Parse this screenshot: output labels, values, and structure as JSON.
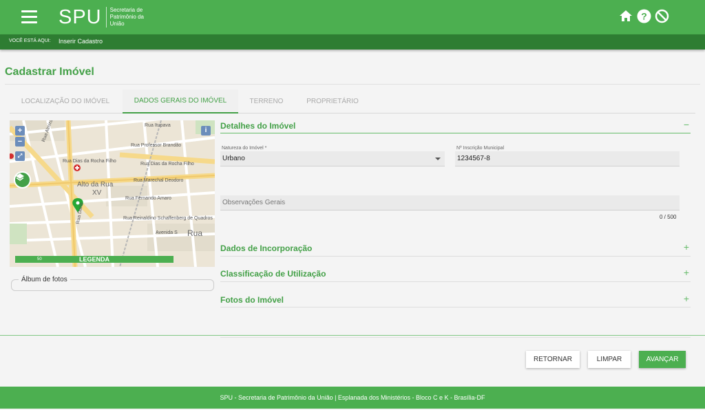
{
  "header": {
    "logo": "SPU",
    "logo_subtitle": "Secretaria de Patrimônio da União",
    "icons": [
      "menu-icon",
      "home-icon",
      "help-icon",
      "block-icon"
    ],
    "brand_color": "#4caf50",
    "dark_color": "#2e7d32"
  },
  "breadcrumb": {
    "label": "VOCÊ ESTÁ AQUI:",
    "current": "Inserir Cadastro"
  },
  "page": {
    "title": "Cadastrar Imóvel"
  },
  "tabs": [
    {
      "label": "LOCALIZAÇÃO DO IMÓVEL",
      "active": false
    },
    {
      "label": "DADOS GERAIS DO IMÓVEL",
      "active": true
    },
    {
      "label": "TERRENO",
      "active": false
    },
    {
      "label": "PROPRIETÁRIO",
      "active": false
    }
  ],
  "map": {
    "zoom_in": "+",
    "zoom_out": "−",
    "info": "i",
    "legend": "LEGENDA",
    "scale": "50",
    "labels": {
      "rua_itupava": "Rua Itupava",
      "rua_professor_brandao": "Rua Professor Brandão",
      "rua_dias_rocha_filho": "Rua Dias da Rocha Filho",
      "rua_dias_rocha_filho_2": "Rua Dias da Rocha Filho",
      "alto_da_rua": "Alto da Rua",
      "xv": "XV",
      "rua_marechal": "Rua Marechal Deodoro",
      "rua_fernando_amaro": "Rua Fernando Amaro",
      "rua_reinaldino": "Rua Reinaldino Schaffenberg de Quadros",
      "avenida": "Avenida S",
      "rua": "Rua",
      "rua_almirante": "Rua Almirante T.",
      "rua_dario": "Rua Dario"
    }
  },
  "album": {
    "label": "Álbum de fotos"
  },
  "details": {
    "section_title": "Detalhes do Imóvel",
    "collapse_symbol": "−",
    "natureza_label": "Natureza do Imóvel *",
    "natureza_value": "Urbano",
    "inscricao_label": "Nº Inscrição Municipal",
    "inscricao_value": "1234567-8",
    "observacoes_placeholder": "Observações Gerais",
    "counter": "0 / 500"
  },
  "sections": [
    {
      "title": "Dados de Incorporação",
      "symbol": "+"
    },
    {
      "title": "Classificação de Utilização",
      "symbol": "+"
    },
    {
      "title": "Fotos do Imóvel",
      "symbol": "+"
    }
  ],
  "actions": {
    "retornar": "RETORNAR",
    "limpar": "LIMPAR",
    "avancar": "AVANÇAR"
  },
  "footer": {
    "text": "SPU - Secretaria de Patrimônio da União | Esplanada dos Ministérios - Bloco C e K - Brasília-DF"
  }
}
